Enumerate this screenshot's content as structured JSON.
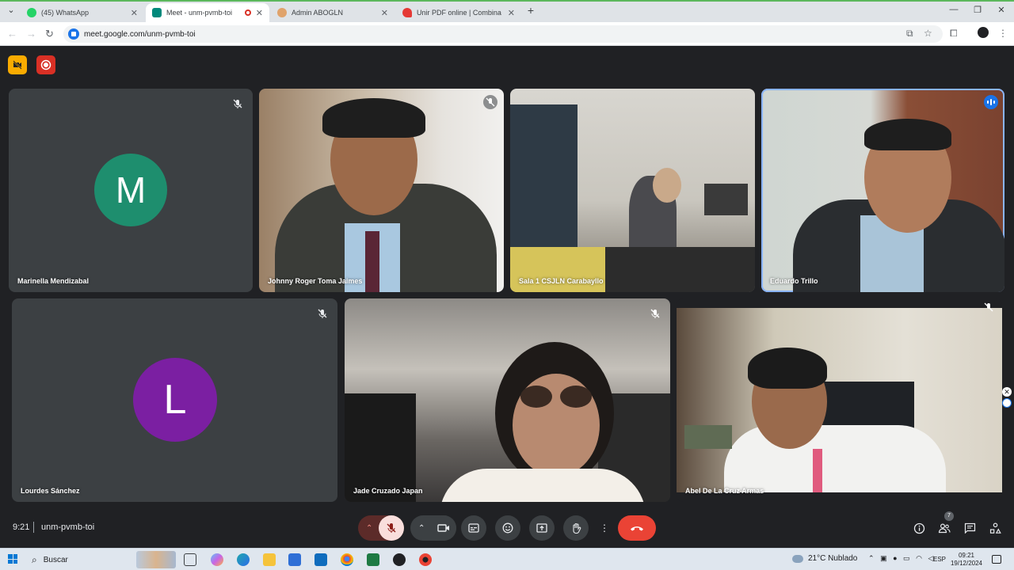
{
  "browser": {
    "tabs": [
      {
        "title": "(45) WhatsApp",
        "favicon_color": "#25d366",
        "active": false
      },
      {
        "title": "Meet - unm-pvmb-toi",
        "favicon_color": "#00897b",
        "active": true
      },
      {
        "title": "Admin ABOGLN",
        "favicon_color": "#e0a36b",
        "active": false
      },
      {
        "title": "Unir PDF online | Combina tus a",
        "favicon_color": "#e53935",
        "active": false
      }
    ],
    "new_tab": "+",
    "url": "meet.google.com/unm-pvmb-toi"
  },
  "meet": {
    "participants": [
      {
        "name": "Marinella Mendizabal",
        "avatar_letter": "M",
        "avatar_color": "#1e8e6e",
        "muted": true,
        "speaking": false
      },
      {
        "name": "Johnny Roger Toma Jaimes",
        "avatar_letter": "",
        "avatar_color": "",
        "muted": true,
        "speaking": false
      },
      {
        "name": "Sala 1 CSJLN Carabayllo",
        "avatar_letter": "",
        "avatar_color": "",
        "muted": false,
        "speaking": false
      },
      {
        "name": "Eduardo Trillo",
        "avatar_letter": "",
        "avatar_color": "",
        "muted": false,
        "speaking": true
      },
      {
        "name": "Lourdes Sánchez",
        "avatar_letter": "L",
        "avatar_color": "#7b1fa2",
        "muted": true,
        "speaking": false
      },
      {
        "name": "Jade Cruzado Japan",
        "avatar_letter": "",
        "avatar_color": "",
        "muted": true,
        "speaking": false
      },
      {
        "name": "Abel De La Cruz Armas",
        "avatar_letter": "",
        "avatar_color": "",
        "muted": true,
        "speaking": false
      }
    ],
    "time": "9:21",
    "meeting_code": "unm-pvmb-toi",
    "people_count": "7",
    "colors": {
      "bg": "#202124",
      "tile": "#3c4043",
      "end_call": "#ea4335",
      "mic_off": "#f9dedc",
      "speaking_outline": "#8ab4f8"
    }
  },
  "taskbar": {
    "search_placeholder": "Buscar",
    "weather": "21°C  Nublado",
    "language": "ESP",
    "clock_time": "09:21",
    "clock_date": "19/12/2024"
  }
}
